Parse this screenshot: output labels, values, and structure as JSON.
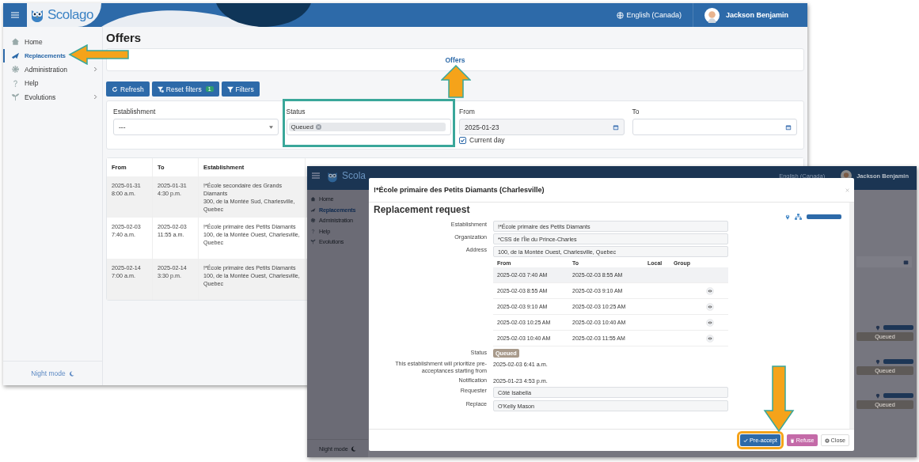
{
  "window_1": {
    "header": {
      "brand": "Scolago",
      "language": "English (Canada)",
      "user": "Jackson Benjamin"
    },
    "sidebar": {
      "items": [
        {
          "label": "Home",
          "selected": false,
          "expandable": false
        },
        {
          "label": "Replacements",
          "selected": true,
          "expandable": false
        },
        {
          "label": "Administration",
          "selected": false,
          "expandable": true
        },
        {
          "label": "Help",
          "selected": false,
          "expandable": false
        },
        {
          "label": "Evolutions",
          "selected": false,
          "expandable": true
        }
      ],
      "night_mode": "Night mode"
    },
    "page_title": "Offers",
    "tabs": [
      {
        "label": "Offers",
        "selected": true
      }
    ],
    "toolbar": {
      "refresh": "Refresh",
      "reset_filters": "Reset filters",
      "reset_count": "1",
      "filters": "Filters"
    },
    "filters": [
      {
        "label": "Establishment",
        "kind": "select",
        "value": "---"
      },
      {
        "label": "Status",
        "kind": "tags",
        "tags": [
          "Queued"
        ],
        "highlighted": true
      },
      {
        "label": "From",
        "kind": "date",
        "value": "2025-01-23",
        "checkbox": {
          "label": "Current day",
          "checked": true
        }
      },
      {
        "label": "To",
        "kind": "date"
      }
    ],
    "table": {
      "columns": [
        "From",
        "To",
        "Establishment"
      ],
      "rows": [
        {
          "from": [
            "2025-01-31",
            "8:00 a.m."
          ],
          "to": [
            "2025-01-31",
            "4:30 p.m."
          ],
          "establishment": "!*École secondaire des Grands Diamants",
          "address": "300, de la Montée Sud, Charlesville, Quebec"
        },
        {
          "from": [
            "2025-02-03",
            "7:40 a.m."
          ],
          "to": [
            "2025-02-03",
            "11:55 a.m."
          ],
          "establishment": "!*École primaire des Petits Diamants",
          "address": "100, de la Montée Ouest, Charlesville, Quebec"
        },
        {
          "from": [
            "2025-02-14",
            "7:00 a.m."
          ],
          "to": [
            "2025-02-14",
            "3:30 p.m."
          ],
          "establishment": "!*École primaire des Petits Diamants",
          "address": "100, de la Montée Ouest, Charlesville, Quebec"
        }
      ]
    }
  },
  "window_2": {
    "header": {
      "brand": "Scola",
      "language": "English (Canada)",
      "user": "Jackson Benjamin"
    },
    "sidebar": {
      "items": [
        {
          "label": "Home",
          "selected": false
        },
        {
          "label": "Replacements",
          "selected": true
        },
        {
          "label": "Administration",
          "selected": false
        },
        {
          "label": "Help",
          "selected": false
        },
        {
          "label": "Evolutions",
          "selected": false
        }
      ],
      "night_mode": "Night mode"
    },
    "background_statuses": [
      "Queued",
      "Queued",
      "Queued"
    ],
    "modal": {
      "title": "!*École primaire des Petits Diamants (Charlesville)",
      "heading": "Replacement request",
      "fields": [
        {
          "label": "Establishment",
          "value": "!*École primaire des Petits Diamants"
        },
        {
          "label": "Organization",
          "value": "*CSS de l'Île du Prince-Charles"
        },
        {
          "label": "Address",
          "value": "100, de la Montée Ouest, Charlesville, Quebec"
        }
      ],
      "schedule": {
        "columns": [
          "From",
          "To",
          "Local",
          "Group"
        ],
        "rows": [
          {
            "from": "2025-02-03 7:40 AM",
            "to": "2025-02-03 8:55 AM",
            "viewable": false
          },
          {
            "from": "2025-02-03 8:55 AM",
            "to": "2025-02-03 9:10 AM",
            "viewable": true
          },
          {
            "from": "2025-02-03 9:10 AM",
            "to": "2025-02-03 10:25 AM",
            "viewable": true
          },
          {
            "from": "2025-02-03 10:25 AM",
            "to": "2025-02-03 10:40 AM",
            "viewable": true
          },
          {
            "from": "2025-02-03 10:40 AM",
            "to": "2025-02-03 11:55 AM",
            "viewable": true
          }
        ]
      },
      "details": [
        {
          "label": "Status",
          "kind": "badge",
          "value": "Queued"
        },
        {
          "label": "This establishment will prioritize pre-acceptances starting from",
          "kind": "text",
          "value": "2025-02-03 6:41 a.m."
        },
        {
          "label": "Notification",
          "kind": "text",
          "value": "2025-01-23 4:53 p.m."
        },
        {
          "label": "Requester",
          "kind": "field",
          "value": "Côté Isabella"
        },
        {
          "label": "Replace",
          "kind": "field",
          "value": "O'Kelly Mason"
        }
      ],
      "buttons": [
        {
          "label": "Pre-accept",
          "kind": "primary",
          "highlighted": true
        },
        {
          "label": "Refuse",
          "kind": "danger",
          "highlighted": false
        },
        {
          "label": "Close",
          "kind": "close",
          "highlighted": false
        }
      ]
    }
  }
}
